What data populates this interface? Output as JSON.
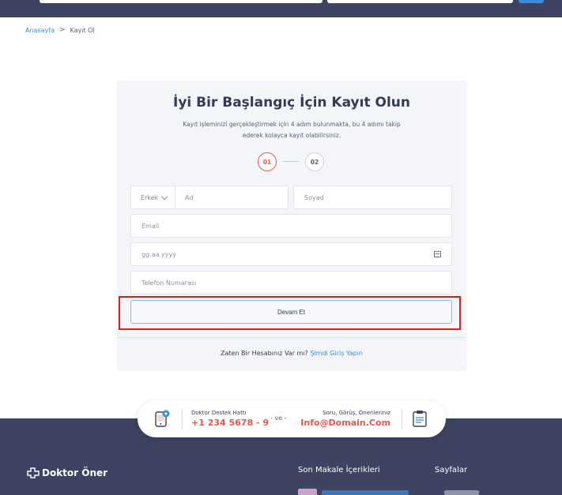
{
  "breadcrumb": {
    "home": "Anasayfa",
    "separator": ">",
    "current": "Kayıt Ol"
  },
  "form": {
    "title": "İyi Bir Başlangıç İçin Kayıt Olun",
    "subtitle": "Kayıt işleminizi gerçekleştirmek için 4 adım bulunmakta, bu 4 adımı takip ederek kolayca kayıt olabilirsiniz.",
    "steps": [
      "01",
      "02"
    ],
    "gender_value": "Erkek",
    "first_name_placeholder": "Ad",
    "last_name_placeholder": "Soyad",
    "email_placeholder": "Email",
    "birthdate_placeholder": "gg.aa.yyyy",
    "phone_placeholder": "Telefon Numarası",
    "continue_label": "Devam Et",
    "login_prompt": "Zaten Bir Hesabınız Var mı?",
    "login_link": "Şimdi Giriş Yapın"
  },
  "support": {
    "left_label": "Doktor Destek Hattı",
    "left_value": "+1 234 5678 - 9",
    "middle": "- ve -",
    "right_label": "Soru, Görüş, Önerileriniz",
    "right_value": "Info@Domain.Com"
  },
  "footer": {
    "brand": "Doktor Öner",
    "recent_posts_title": "Son Makale İçerikleri",
    "pages_title": "Sayfalar"
  },
  "colors": {
    "accent_red": "#e8574f",
    "link_blue": "#3a8ddb",
    "dark_navy": "#3d4360",
    "highlight_red": "#e11a1a"
  }
}
